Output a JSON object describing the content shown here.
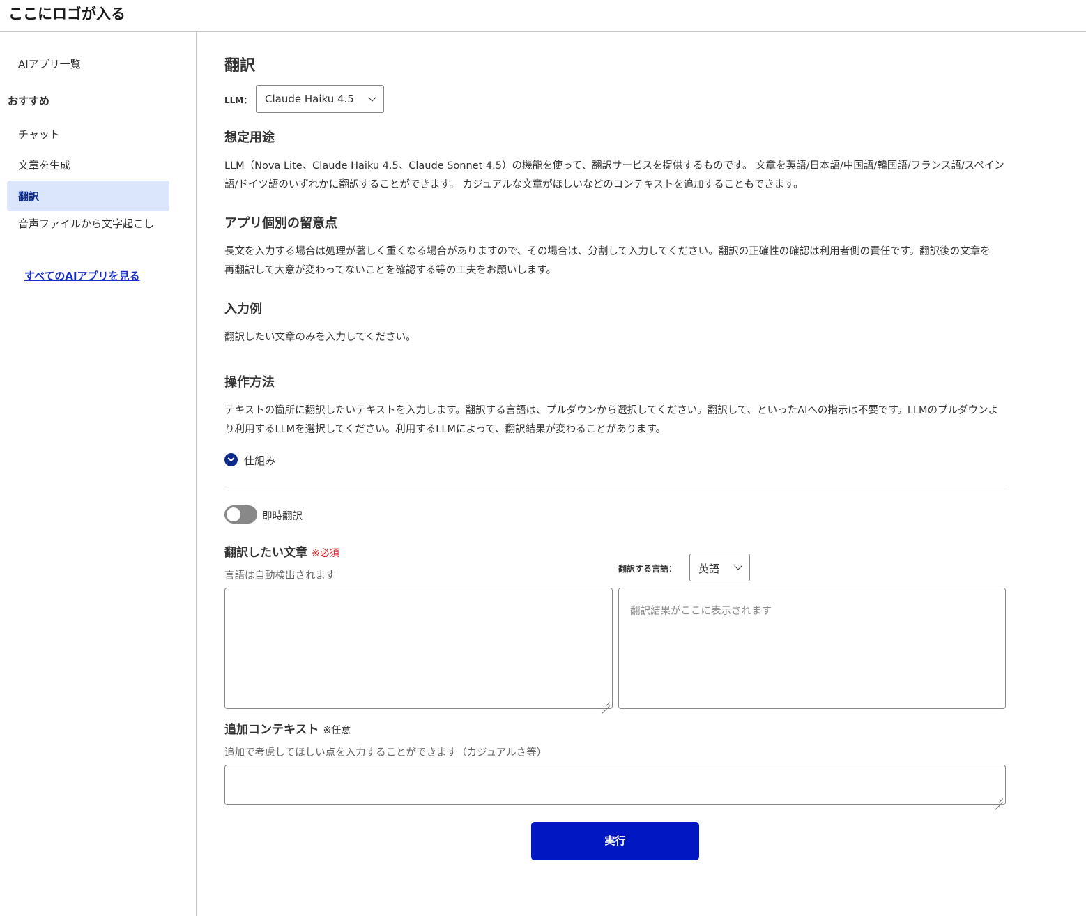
{
  "header": {
    "logo": "ここにロゴが入る"
  },
  "sidebar": {
    "app_list": "AIアプリ一覧",
    "section_heading": "おすすめ",
    "items": [
      {
        "label": "チャット"
      },
      {
        "label": "文章を生成"
      },
      {
        "label": "翻訳",
        "active": true
      },
      {
        "label": "音声ファイルから文字起こし"
      }
    ],
    "see_all": "すべてのAIアプリを見る"
  },
  "main": {
    "title": "翻訳",
    "llm_label": "LLM：",
    "llm_selected": "Claude Haiku 4.5",
    "sections": [
      {
        "heading": "想定用途",
        "text": "LLM（Nova Lite、Claude Haiku 4.5、Claude Sonnet 4.5）の機能を使って、翻訳サービスを提供するものです。 文章を英語/日本語/中国語/韓国語/フランス語/スペイン語/ドイツ語のいずれかに翻訳することができます。 カジュアルな文章がほしいなどのコンテキストを追加することもできます。"
      },
      {
        "heading": "アプリ個別の留意点",
        "text": "長文を入力する場合は処理が著しく重くなる場合がありますので、その場合は、分割して入力してください。翻訳の正確性の確認は利用者側の責任です。翻訳後の文章を再翻訳して大意が変わってないことを確認する等の工夫をお願いします。"
      },
      {
        "heading": "入力例",
        "text": "翻訳したい文章のみを入力してください。"
      },
      {
        "heading": "操作方法",
        "text": "テキストの箇所に翻訳したいテキストを入力します。翻訳する言語は、プルダウンから選択してください。翻訳して、といったAIへの指示は不要です。LLMのプルダウンより利用するLLMを選択してください。利用するLLMによって、翻訳結果が変わることがあります。"
      }
    ],
    "mechanism_label": "仕組み",
    "instant_toggle_label": "即時翻訳",
    "instant_toggle_on": false,
    "source": {
      "label": "翻訳したい文章",
      "required": "※必須",
      "hint": "言語は自動検出されます",
      "value": ""
    },
    "target": {
      "label": "翻訳する言語：",
      "selected": "英語",
      "placeholder": "翻訳結果がここに表示されます"
    },
    "context": {
      "label": "追加コンテキスト",
      "optional": "※任意",
      "hint": "追加で考慮してほしい点を入力することができます（カジュアルさ等）",
      "value": ""
    },
    "run_button": "実行"
  },
  "colors": {
    "accent": "#0017c1",
    "active_bg": "#dbe6fd",
    "active_text": "#0b2a8c",
    "required": "#d9262b",
    "link": "#1a2fc9",
    "toggle_off": "#888888"
  }
}
